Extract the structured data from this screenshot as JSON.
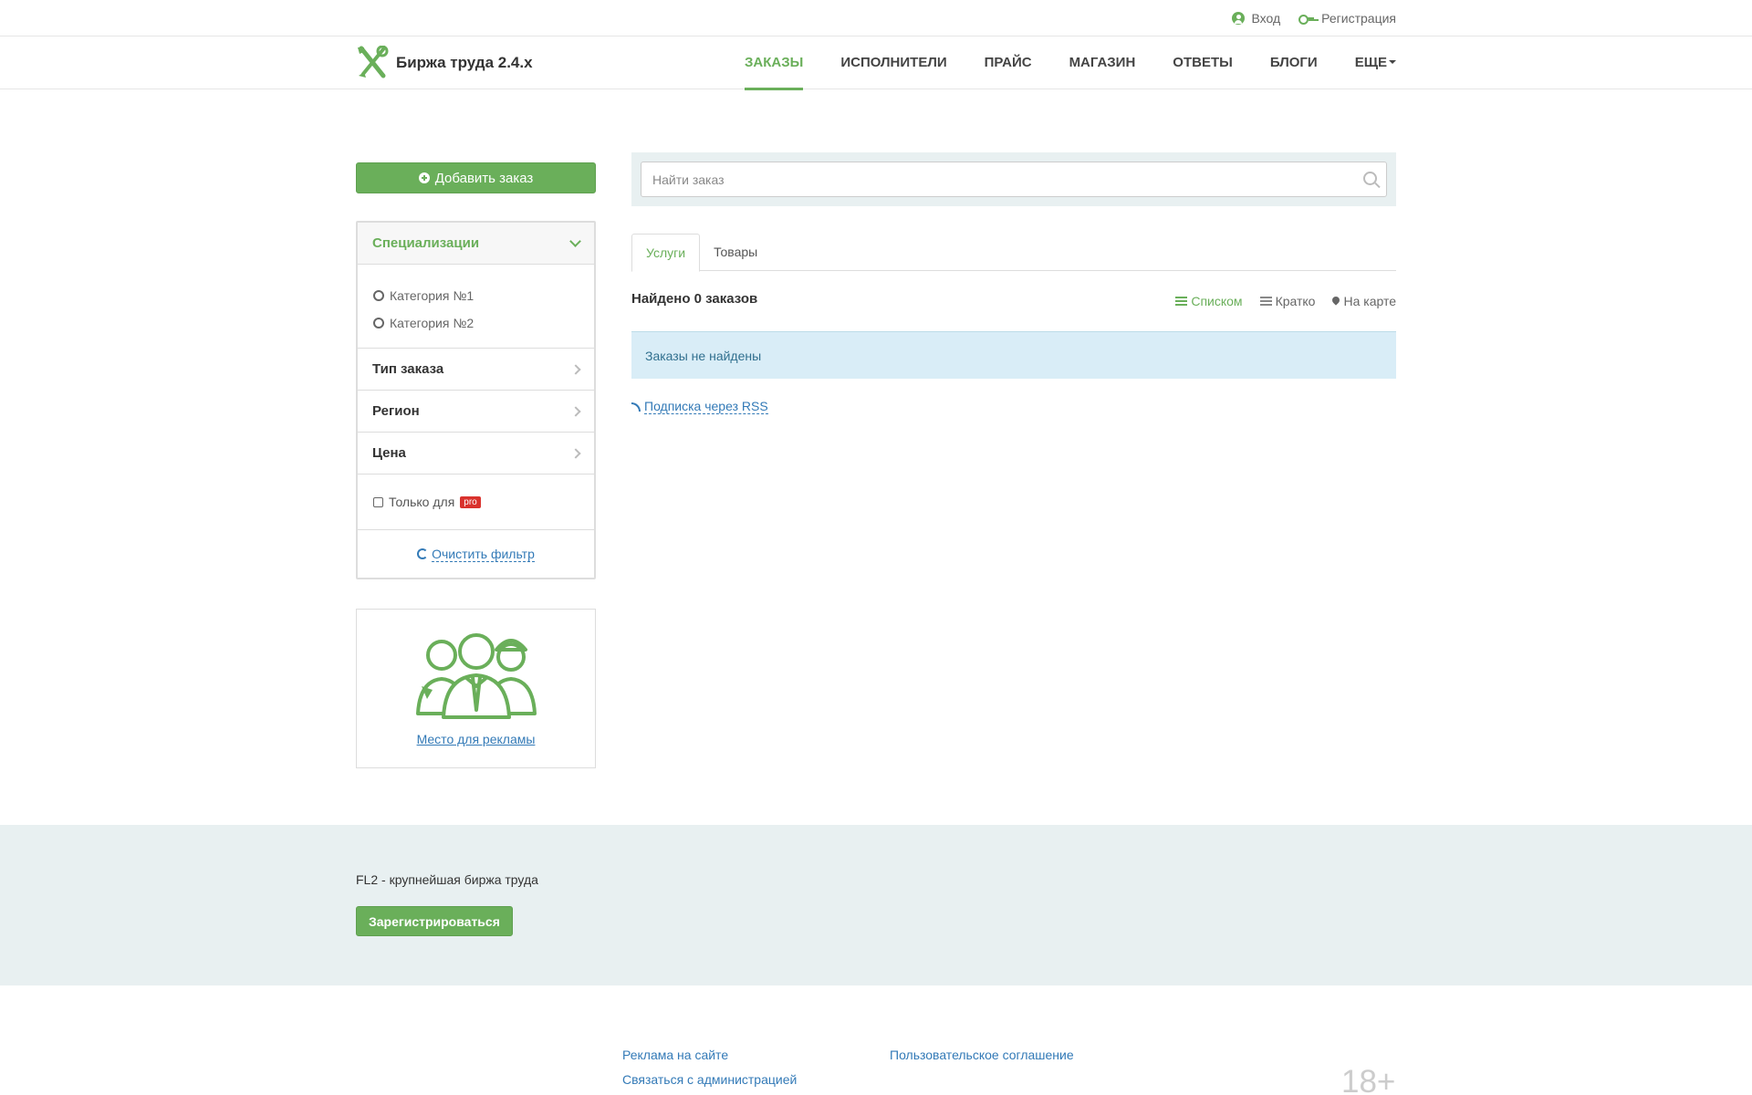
{
  "topbar": {
    "login": "Вход",
    "register": "Регистрация"
  },
  "brand": {
    "title": "Биржа труда 2.4.x"
  },
  "nav": {
    "items": [
      {
        "label": "ЗАКАЗЫ"
      },
      {
        "label": "ИСПОЛНИТЕЛИ"
      },
      {
        "label": "ПРАЙС"
      },
      {
        "label": "МАГАЗИН"
      },
      {
        "label": "ОТВЕТЫ"
      },
      {
        "label": "БЛОГИ"
      },
      {
        "label": "ЕЩЕ"
      }
    ]
  },
  "sidebar": {
    "add_order": "Добавить заказ",
    "filter": {
      "specializations": "Специализации",
      "categories": [
        "Категория №1",
        "Категория №2"
      ],
      "order_type": "Тип заказа",
      "region": "Регион",
      "price": "Цена",
      "only_for": "Только для",
      "pro_badge": "pro",
      "clear": "Очистить фильтр"
    },
    "ad": {
      "link": "Место для рекламы"
    }
  },
  "main": {
    "search": {
      "placeholder": "Найти заказ"
    },
    "tabs": [
      {
        "label": "Услуги"
      },
      {
        "label": "Товары"
      }
    ],
    "results_count": "Найдено 0 заказов",
    "views": [
      {
        "label": "Списком"
      },
      {
        "label": "Кратко"
      },
      {
        "label": "На карте"
      }
    ],
    "empty_message": "Заказы не найдены",
    "rss": "Подписка через RSS"
  },
  "footer": {
    "slogan": "FL2 - крупнейшая биржа труда",
    "register_button": "Зарегистрироваться",
    "links_col1": [
      "Реклама на сайте",
      "Связаться с администрацией"
    ],
    "links_col2": [
      "Пользовательское соглашение"
    ],
    "age_mark": "18+"
  },
  "colors": {
    "accent": "#6aaf5a",
    "link": "#337ab7",
    "info_bg": "#d9edf7",
    "footer_bg": "#e8f0f1",
    "pro_badge": "#d9322d"
  }
}
